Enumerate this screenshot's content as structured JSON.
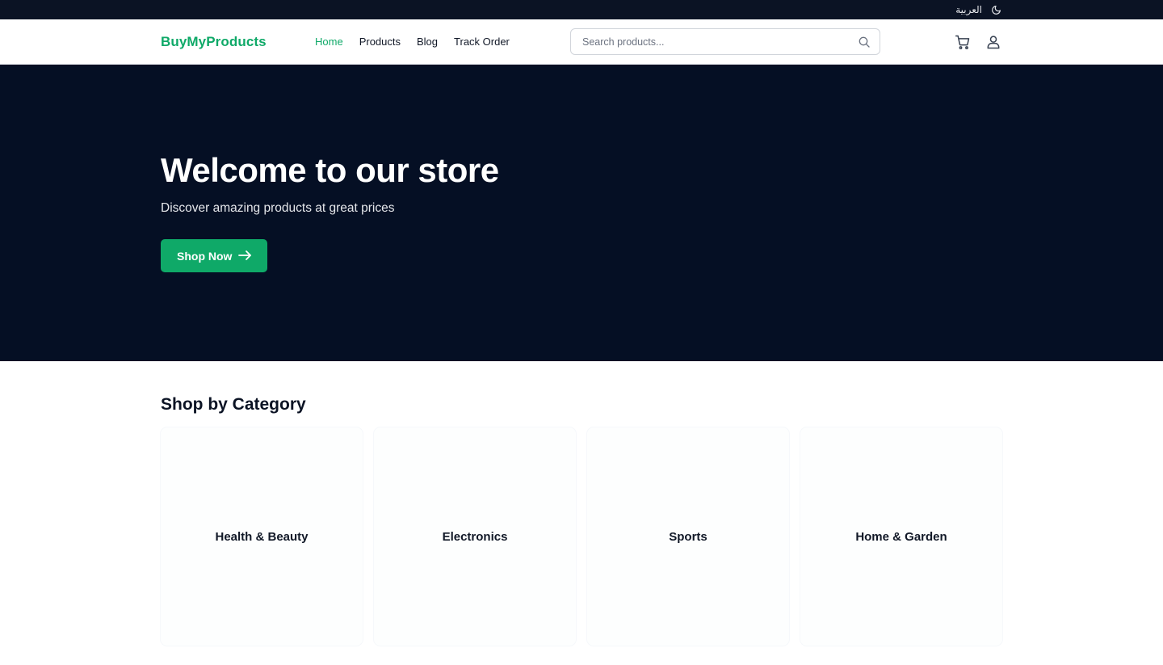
{
  "topbar": {
    "language_label": "العربية",
    "theme_icon": "moon-icon"
  },
  "header": {
    "logo": "BuyMyProducts",
    "nav": [
      {
        "label": "Home",
        "active": true
      },
      {
        "label": "Products",
        "active": false
      },
      {
        "label": "Blog",
        "active": false
      },
      {
        "label": "Track Order",
        "active": false
      }
    ],
    "search": {
      "placeholder": "Search products...",
      "value": "",
      "icon": "search-icon"
    },
    "icons": [
      "cart-icon",
      "user-icon"
    ]
  },
  "hero": {
    "title": "Welcome to our store",
    "subtitle": "Discover amazing products at great prices",
    "cta_label": "Shop Now",
    "cta_icon": "arrow-right-icon"
  },
  "categories": {
    "heading": "Shop by Category",
    "items": [
      {
        "label": "Health & Beauty"
      },
      {
        "label": "Electronics"
      },
      {
        "label": "Sports"
      },
      {
        "label": "Home & Garden"
      }
    ]
  },
  "colors": {
    "brand": "#0fa968",
    "hero_bg": "#050f24",
    "topbar_bg": "#0b1324"
  }
}
